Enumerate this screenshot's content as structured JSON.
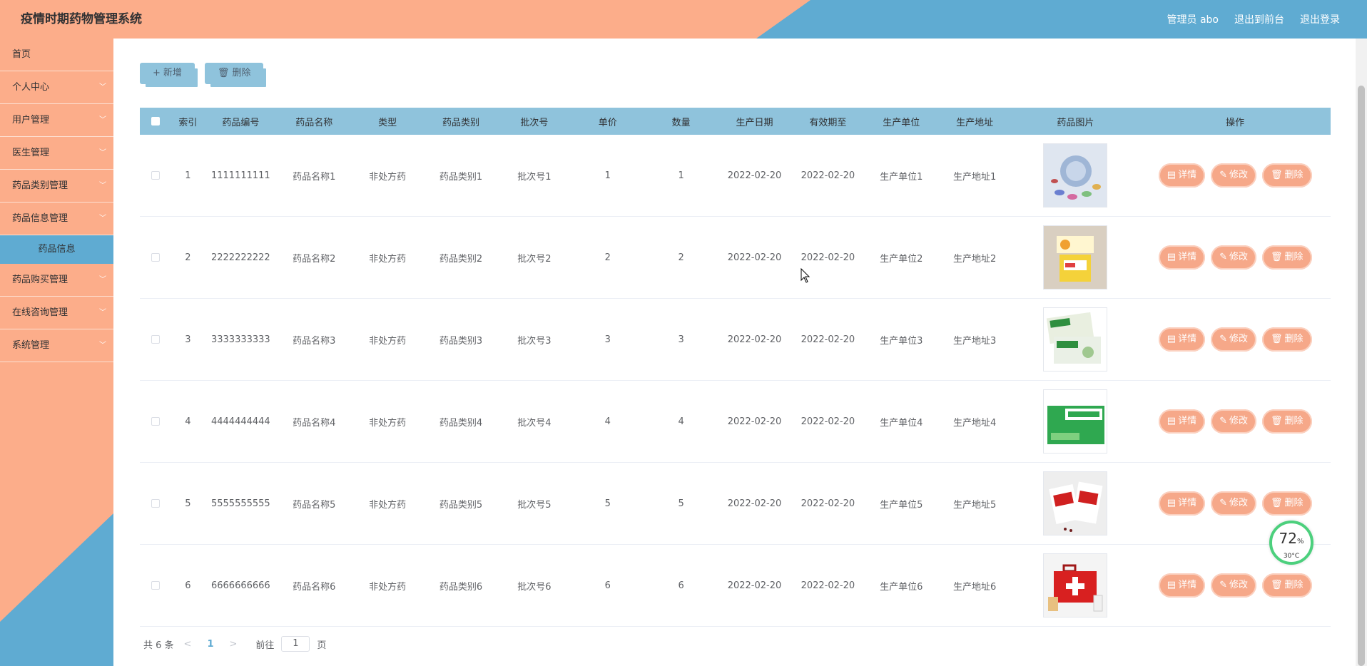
{
  "header": {
    "title": "疫情时期药物管理系统",
    "user": "管理员 abo",
    "front_link": "退出到前台",
    "logout": "退出登录"
  },
  "sidebar": {
    "items": [
      {
        "label": "首页",
        "expandable": false
      },
      {
        "label": "个人中心",
        "expandable": true
      },
      {
        "label": "用户管理",
        "expandable": true
      },
      {
        "label": "医生管理",
        "expandable": true
      },
      {
        "label": "药品类别管理",
        "expandable": true
      },
      {
        "label": "药品信息管理",
        "expandable": true
      },
      {
        "label": "药品信息",
        "sub": true,
        "active": true
      },
      {
        "label": "药品购买管理",
        "expandable": true
      },
      {
        "label": "在线咨询管理",
        "expandable": true
      },
      {
        "label": "系统管理",
        "expandable": true
      }
    ]
  },
  "toolbar": {
    "add_label": "新增",
    "delete_label": "删除"
  },
  "table": {
    "columns": [
      "索引",
      "药品编号",
      "药品名称",
      "类型",
      "药品类别",
      "批次号",
      "单价",
      "数量",
      "生产日期",
      "有效期至",
      "生产单位",
      "生产地址",
      "药品图片",
      "操作"
    ],
    "rows": [
      {
        "index": "1",
        "code": "1111111111",
        "name": "药品名称1",
        "type": "非处方药",
        "category": "药品类别1",
        "batch": "批次号1",
        "price": "1",
        "qty": "1",
        "mfg": "2022-02-20",
        "exp": "2022-02-20",
        "maker": "生产单位1",
        "address": "生产地址1",
        "image": "medicine-pills-image"
      },
      {
        "index": "2",
        "code": "2222222222",
        "name": "药品名称2",
        "type": "非处方药",
        "category": "药品类别2",
        "batch": "批次号2",
        "price": "2",
        "qty": "2",
        "mfg": "2022-02-20",
        "exp": "2022-02-20",
        "maker": "生产单位2",
        "address": "生产地址2",
        "image": "medicine-box-yellow-image"
      },
      {
        "index": "3",
        "code": "3333333333",
        "name": "药品名称3",
        "type": "非处方药",
        "category": "药品类别3",
        "batch": "批次号3",
        "price": "3",
        "qty": "3",
        "mfg": "2022-02-20",
        "exp": "2022-02-20",
        "maker": "生产单位3",
        "address": "生产地址3",
        "image": "medicine-box-green-image"
      },
      {
        "index": "4",
        "code": "4444444444",
        "name": "药品名称4",
        "type": "非处方药",
        "category": "药品类别4",
        "batch": "批次号4",
        "price": "4",
        "qty": "4",
        "mfg": "2022-02-20",
        "exp": "2022-02-20",
        "maker": "生产单位4",
        "address": "生产地址4",
        "image": "medicine-granules-image"
      },
      {
        "index": "5",
        "code": "5555555555",
        "name": "药品名称5",
        "type": "非处方药",
        "category": "药品类别5",
        "batch": "批次号5",
        "price": "5",
        "qty": "5",
        "mfg": "2022-02-20",
        "exp": "2022-02-20",
        "maker": "生产单位5",
        "address": "生产地址5",
        "image": "medicine-box-red-image"
      },
      {
        "index": "6",
        "code": "6666666666",
        "name": "药品名称6",
        "type": "非处方药",
        "category": "药品类别6",
        "batch": "批次号6",
        "price": "6",
        "qty": "6",
        "mfg": "2022-02-20",
        "exp": "2022-02-20",
        "maker": "生产单位6",
        "address": "生产地址6",
        "image": "first-aid-kit-image"
      }
    ],
    "actions": {
      "detail": "详情",
      "edit": "修改",
      "delete": "删除"
    }
  },
  "pagination": {
    "total_text": "共 6 条",
    "current_page": "1",
    "goto_prefix": "前往",
    "goto_value": "1",
    "goto_suffix": "页"
  },
  "widget": {
    "percent": "72",
    "percent_unit": "%",
    "temperature": "30°C"
  },
  "colors": {
    "header_salmon": "#fcad8a",
    "accent_blue": "#5fabd2",
    "table_header": "#8fc3dc",
    "action_button": "#f6a889"
  }
}
